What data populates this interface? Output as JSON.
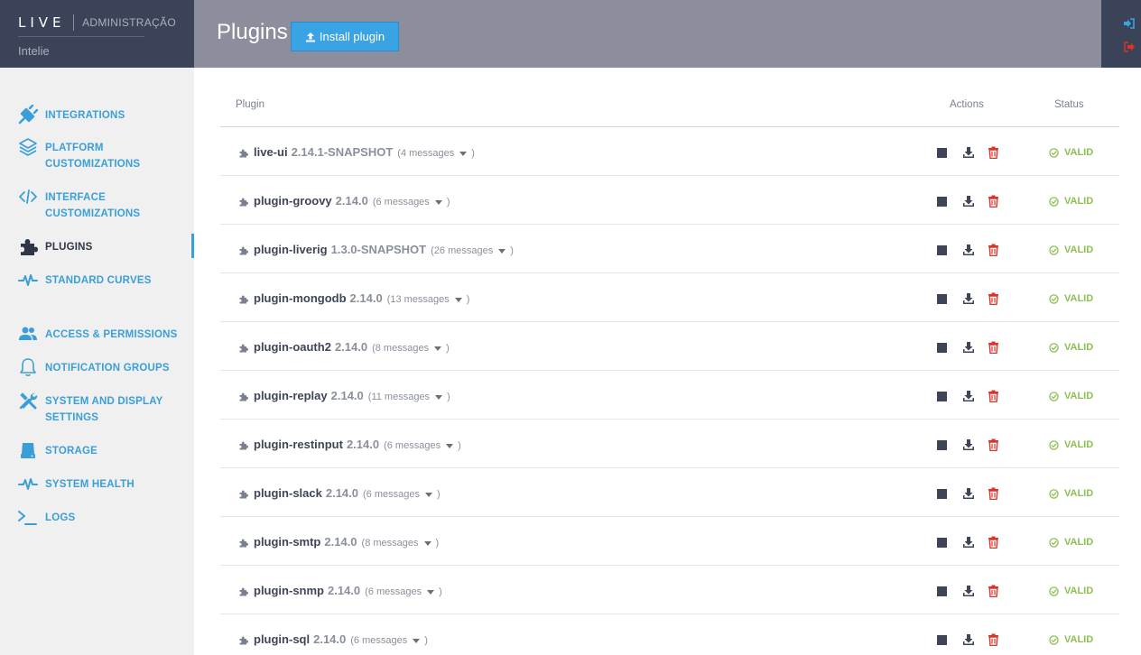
{
  "brand": {
    "logo": "LIVE",
    "section": "ADMINISTRAÇÃO",
    "organization": "Intelie"
  },
  "sidebar": {
    "items": [
      {
        "label": "INTEGRATIONS",
        "icon": "plug-icon"
      },
      {
        "label": "PLATFORM CUSTOMIZATIONS",
        "icon": "layers-icon"
      },
      {
        "label": "INTERFACE CUSTOMIZATIONS",
        "icon": "code-icon"
      },
      {
        "label": "PLUGINS",
        "icon": "puzzle-icon",
        "active": true
      },
      {
        "label": "STANDARD CURVES",
        "icon": "pulse-icon"
      },
      {
        "label": "ACCESS & PERMISSIONS",
        "icon": "users-icon"
      },
      {
        "label": "NOTIFICATION GROUPS",
        "icon": "bell-icon"
      },
      {
        "label": "SYSTEM AND DISPLAY SETTINGS",
        "icon": "tools-icon"
      },
      {
        "label": "STORAGE",
        "icon": "storage-icon"
      },
      {
        "label": "SYSTEM HEALTH",
        "icon": "pulse-icon"
      },
      {
        "label": "LOGS",
        "icon": "terminal-icon"
      }
    ]
  },
  "header": {
    "title": "Plugins",
    "install_label": "Install plugin"
  },
  "table": {
    "columns": {
      "plugin": "Plugin",
      "actions": "Actions",
      "status": "Status"
    },
    "rows": [
      {
        "name": "live-ui",
        "version": "2.14.1-SNAPSHOT",
        "messages": "(4 messages",
        "close": ")",
        "status": "VALID"
      },
      {
        "name": "plugin-groovy",
        "version": "2.14.0",
        "messages": "(6 messages",
        "close": ")",
        "status": "VALID"
      },
      {
        "name": "plugin-liverig",
        "version": "1.3.0-SNAPSHOT",
        "messages": "(26 messages",
        "close": ")",
        "status": "VALID"
      },
      {
        "name": "plugin-mongodb",
        "version": "2.14.0",
        "messages": "(13 messages",
        "close": ")",
        "status": "VALID"
      },
      {
        "name": "plugin-oauth2",
        "version": "2.14.0",
        "messages": "(8 messages",
        "close": ")",
        "status": "VALID"
      },
      {
        "name": "plugin-replay",
        "version": "2.14.0",
        "messages": "(11 messages",
        "close": ")",
        "status": "VALID"
      },
      {
        "name": "plugin-restinput",
        "version": "2.14.0",
        "messages": "(6 messages",
        "close": ")",
        "status": "VALID"
      },
      {
        "name": "plugin-slack",
        "version": "2.14.0",
        "messages": "(6 messages",
        "close": ")",
        "status": "VALID"
      },
      {
        "name": "plugin-smtp",
        "version": "2.14.0",
        "messages": "(8 messages",
        "close": ")",
        "status": "VALID"
      },
      {
        "name": "plugin-snmp",
        "version": "2.14.0",
        "messages": "(6 messages",
        "close": ")",
        "status": "VALID"
      },
      {
        "name": "plugin-sql",
        "version": "2.14.0",
        "messages": "(6 messages",
        "close": ")",
        "status": "VALID"
      }
    ]
  },
  "colors": {
    "accent": "#3a9fd8",
    "valid": "#8cc152",
    "delete": "#d9342b",
    "header_bg": "#8d8e9d",
    "brand_bg": "#3a4357"
  }
}
